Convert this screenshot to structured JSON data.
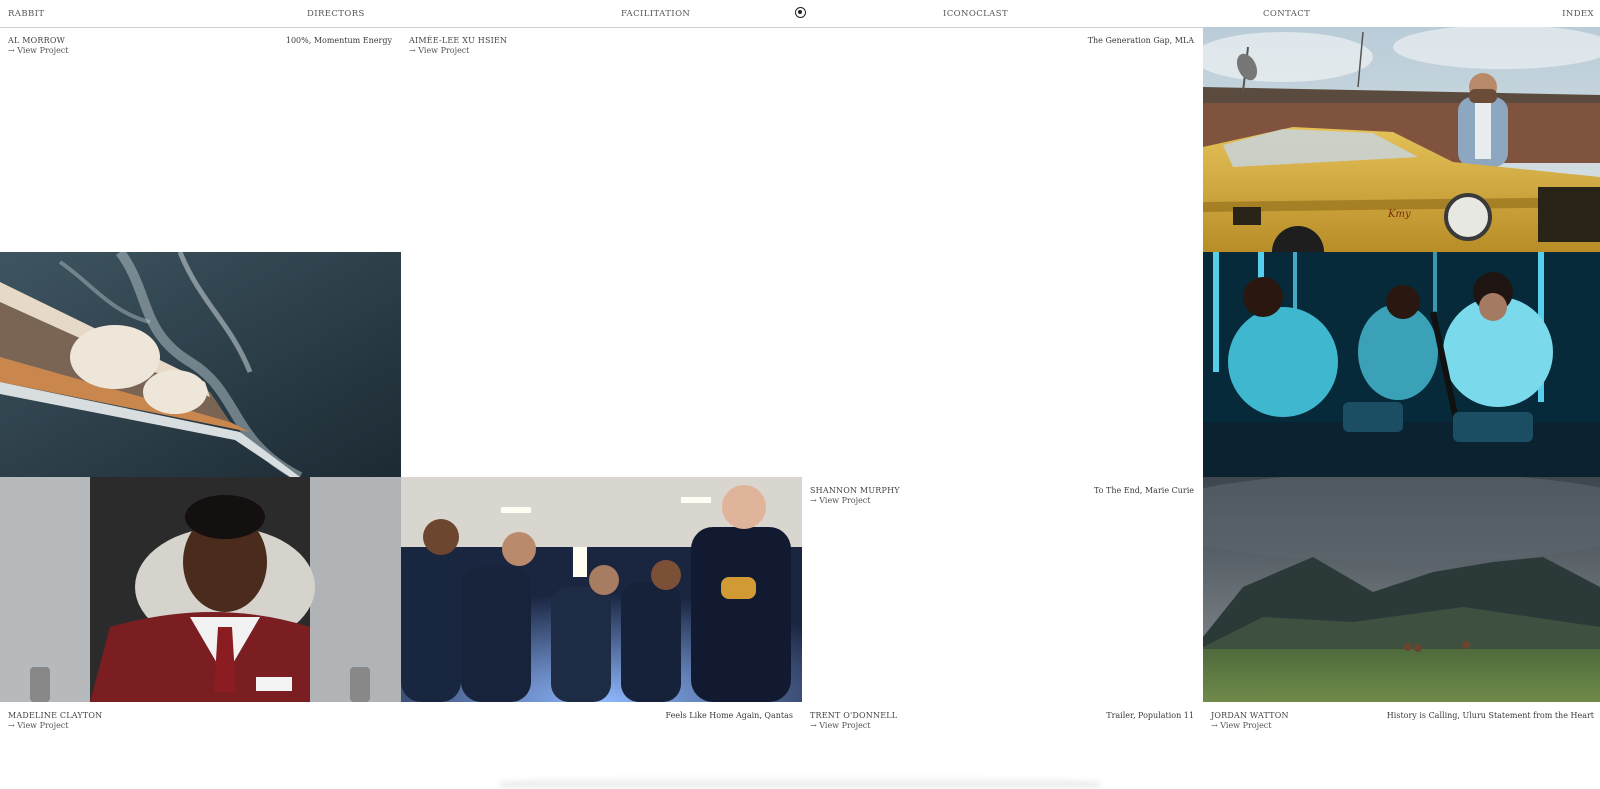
{
  "nav": {
    "brand": "RABBIT",
    "items": [
      "DIRECTORS",
      "FACILITATION",
      "ICONOCLAST",
      "CONTACT",
      "INDEX"
    ],
    "logo_icon": "rabbit-logo-icon"
  },
  "view_label": "→ View Project",
  "tiles": [
    {
      "director": "AL MORROW",
      "project": "100%, Momentum Energy"
    },
    {
      "director": "AIMÉE-LEE XU HSIEN",
      "project": "The Generation Gap, MLA"
    },
    {
      "director": "SHANNON MURPHY",
      "project": "To The End, Marie Curie"
    },
    {
      "director": "MADELINE CLAYTON",
      "project": "Feels Like Home Again, Qantas"
    },
    {
      "director": "TRENT O'DONNELL",
      "project": "Trailer, Population 11"
    },
    {
      "director": "JORDAN WATTON",
      "project": "History is Calling, Uluru Statement from the Heart"
    }
  ],
  "images": [
    "man-with-yellow-car-photo",
    "ship-over-ocean-photo",
    "spin-class-photo",
    "airline-worker-photo",
    "group-looking-down-photo",
    "mountain-valley-photo"
  ]
}
